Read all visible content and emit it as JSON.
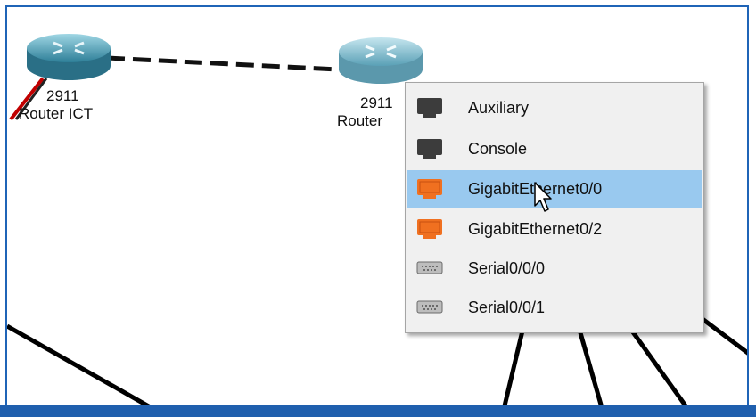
{
  "devices": [
    {
      "model": "2911",
      "name": "Router ICT"
    },
    {
      "model": "2911",
      "name": "Router"
    }
  ],
  "context_menu": {
    "items": [
      {
        "label": "Auxiliary",
        "icon": "auxiliary-port-icon",
        "icon_color": "#3c3c3c",
        "selected": false
      },
      {
        "label": "Console",
        "icon": "console-port-icon",
        "icon_color": "#3c3c3c",
        "selected": false
      },
      {
        "label": "GigabitEthernet0/0",
        "icon": "ethernet-port-icon",
        "icon_color": "#f07020",
        "selected": true
      },
      {
        "label": "GigabitEthernet0/2",
        "icon": "ethernet-port-icon",
        "icon_color": "#f07020",
        "selected": false
      },
      {
        "label": "Serial0/0/0",
        "icon": "serial-port-icon",
        "icon_color": "#bdbdbd",
        "selected": false
      },
      {
        "label": "Serial0/0/1",
        "icon": "serial-port-icon",
        "icon_color": "#bdbdbd",
        "selected": false
      }
    ]
  },
  "colors": {
    "frame_border": "#1f64b7",
    "highlight": "#99c9ef",
    "menu_background": "#f0f0f0"
  }
}
